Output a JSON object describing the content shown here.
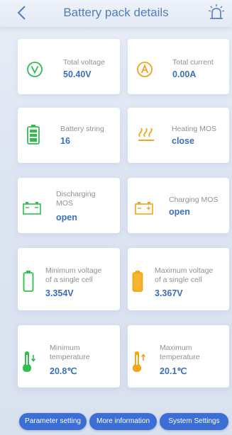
{
  "header": {
    "title": "Battery pack details"
  },
  "cards": {
    "total_voltage": {
      "label": "Total voltage",
      "value": "50.40V"
    },
    "total_current": {
      "label": "Total current",
      "value": "0.00A"
    },
    "battery_string": {
      "label": "Battery string",
      "value": "16"
    },
    "heating_mos": {
      "label": "Heating MOS",
      "value": "close"
    },
    "discharging_mos": {
      "label_line1": "Discharging",
      "label_line2": "MOS",
      "value": "open"
    },
    "charging_mos": {
      "label": "Charging MOS",
      "value": "open"
    },
    "min_cell_voltage": {
      "label_line1": "Minimum voltage",
      "label_line2": "of a single cell",
      "value": "3.354V"
    },
    "max_cell_voltage": {
      "label_line1": "Maximum voltage",
      "label_line2": "of a single cell",
      "value": "3.367V"
    },
    "min_temperature": {
      "label_line1": "Minimum",
      "label_line2": "temperature",
      "value": "20.8℃"
    },
    "max_temperature": {
      "label_line1": "Maximum",
      "label_line2": "temperature",
      "value": "20.1℃"
    }
  },
  "bottom_nav": {
    "parameter_setting": "Parameter setting",
    "more_information": "More information",
    "system_settings": "System Settings"
  },
  "colors": {
    "accent_blue": "#3a6fc0",
    "title_blue": "#4f7ec4",
    "green": "#2fbf4f",
    "orange": "#f2a51a",
    "button_blue": "#3b6fd6"
  },
  "icons": {
    "back": "chevron-left-icon",
    "alarm": "alarm-icon",
    "voltage": "voltage-icon",
    "current": "current-icon",
    "battery_string": "battery-icon",
    "heating": "heating-icon",
    "discharging": "discharging-battery-icon",
    "charging": "charging-battery-icon",
    "min_cell": "battery-low-icon",
    "max_cell": "battery-high-icon",
    "min_temp": "thermometer-down-icon",
    "max_temp": "thermometer-up-icon"
  }
}
